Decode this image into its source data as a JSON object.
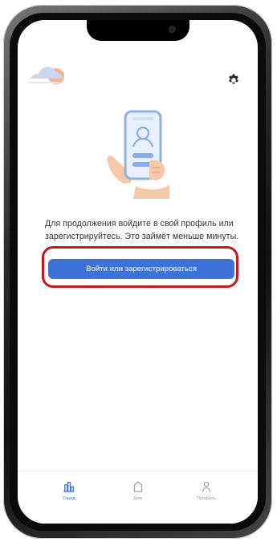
{
  "message": "Для продолжения войдите в свой профиль или зарегистрируйтесь. Это займёт меньше минуты.",
  "buttons": {
    "primary_label": "Войти или зарегистрироваться"
  },
  "icons": {
    "settings": "gear-icon",
    "hero": "phone-hand-illustration",
    "top_left": "cloud-sun-illustration",
    "tabs": [
      "city-icon",
      "home-icon",
      "profile-icon"
    ]
  },
  "tabs": [
    {
      "label": "Город",
      "active": true
    },
    {
      "label": "Дом",
      "active": false
    },
    {
      "label": "Профиль",
      "active": false
    }
  ],
  "colors": {
    "primary": "#3d72d8",
    "highlight": "#c4161f",
    "tab_inactive": "#9ca3af",
    "text": "#333333"
  }
}
